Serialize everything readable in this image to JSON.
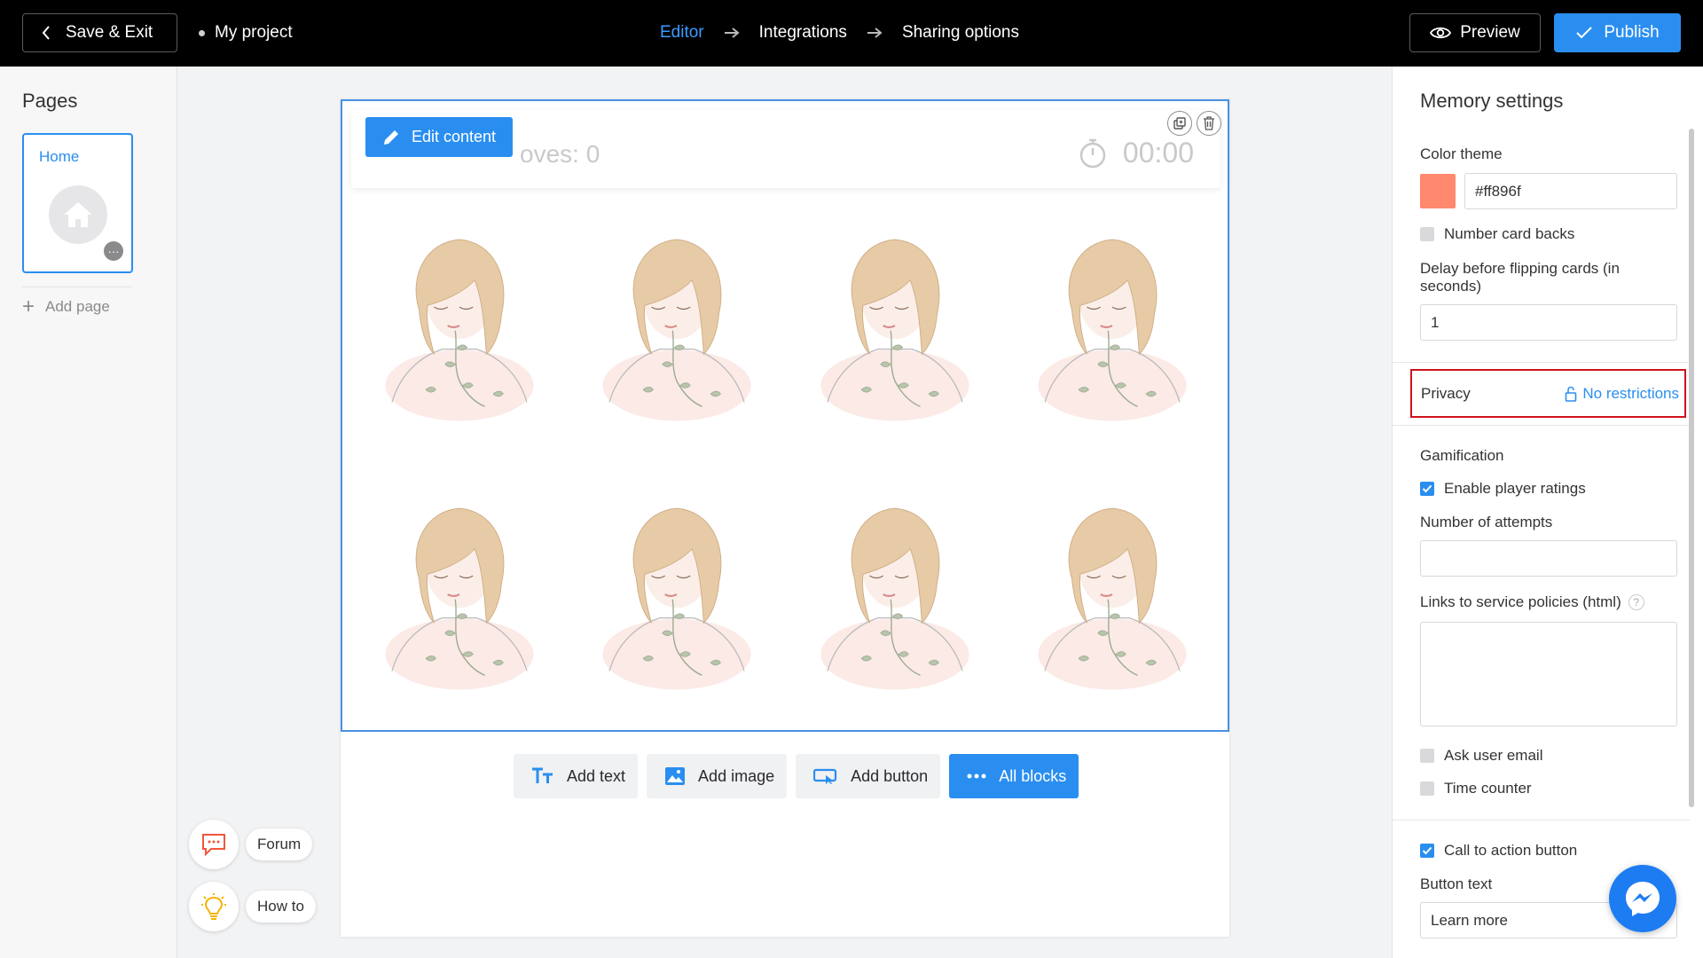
{
  "topbar": {
    "save_exit_label": "Save & Exit",
    "project_name": "My project",
    "steps": [
      "Editor",
      "Integrations",
      "Sharing options"
    ],
    "preview_label": "Preview",
    "publish_label": "Publish"
  },
  "pages_panel": {
    "title": "Pages",
    "pages": [
      {
        "label": "Home",
        "icon": "home-icon"
      }
    ],
    "add_page_label": "Add page"
  },
  "help": {
    "forum_label": "Forum",
    "howto_label": "How to"
  },
  "game": {
    "edit_content_label": "Edit content",
    "moves_text": "oves:",
    "moves_value": "0",
    "timer_value": "00:00",
    "cards_count_shown": 8
  },
  "add_blocks": {
    "add_text": "Add text",
    "add_image": "Add image",
    "add_button": "Add button",
    "all_blocks": "All blocks"
  },
  "settings": {
    "title": "Memory settings",
    "color_theme_label": "Color theme",
    "color_theme_value": "#ff896f",
    "number_card_backs_label": "Number card backs",
    "number_card_backs_checked": false,
    "delay_label": "Delay before flipping cards (in seconds)",
    "delay_value": "1",
    "privacy_label": "Privacy",
    "privacy_value": "No restrictions",
    "gamification_label": "Gamification",
    "enable_ratings_label": "Enable player ratings",
    "enable_ratings_checked": true,
    "attempts_label": "Number of attempts",
    "attempts_value": "",
    "policies_label": "Links to service policies (html)",
    "policies_value": "",
    "ask_email_label": "Ask user email",
    "ask_email_checked": false,
    "time_counter_label": "Time counter",
    "time_counter_checked": false,
    "cta_label": "Call to action button",
    "cta_checked": true,
    "button_text_label": "Button text",
    "button_text_value": "Learn more"
  },
  "colors": {
    "accent": "#2a8ef0",
    "topbar": "#000000",
    "highlight": "#d0121b",
    "theme": "#ff896f"
  }
}
